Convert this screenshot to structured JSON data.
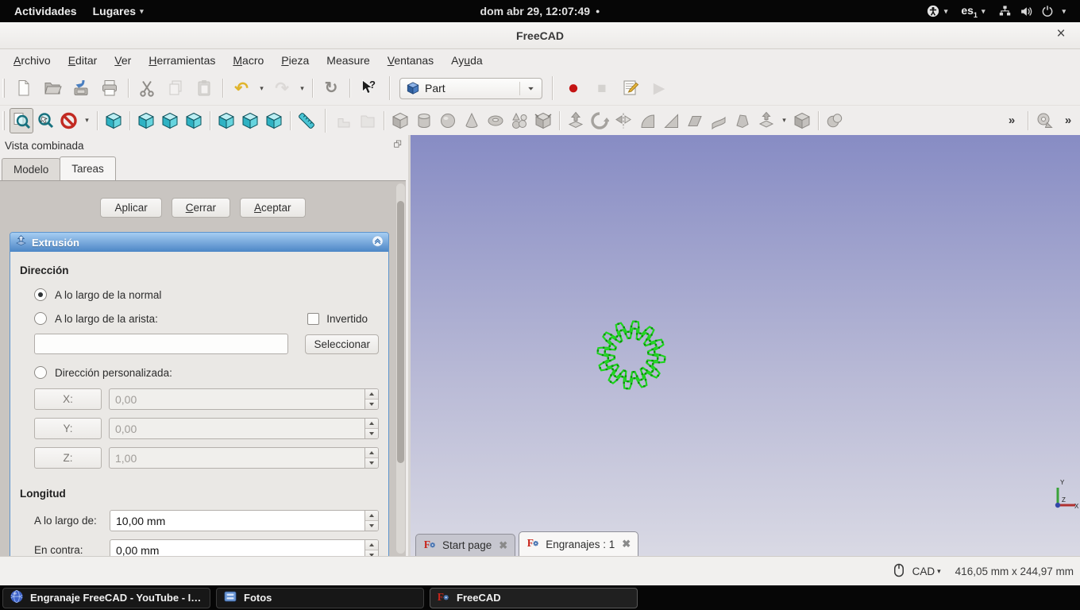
{
  "colors": {
    "accent_blue": "#4c86c6",
    "task_header_gradient_top": "#a6cdf2",
    "task_header_gradient_bottom": "#4c86c6",
    "viewport_gradient_top": "#878cc4",
    "viewport_gradient_bottom": "#d9d9e4",
    "gear_green": "#1ed41e",
    "gear_green_dark": "#0b8f0b",
    "record_red": "#c41414",
    "view_icon_teal": "#2fb2c3"
  },
  "top_bar": {
    "activities_label": "Actividades",
    "places_label": "Lugares",
    "clock": "dom abr 29, 12:07:49",
    "keyboard_layout": "es",
    "keyboard_layout_index": "1"
  },
  "window": {
    "title": "FreeCAD"
  },
  "menu_bar": {
    "items": [
      {
        "id": "archivo",
        "pre": "",
        "key": "A",
        "post": "rchivo"
      },
      {
        "id": "editar",
        "pre": "",
        "key": "E",
        "post": "ditar"
      },
      {
        "id": "ver",
        "pre": "",
        "key": "V",
        "post": "er"
      },
      {
        "id": "herramientas",
        "pre": "",
        "key": "H",
        "post": "erramientas"
      },
      {
        "id": "macro",
        "pre": "",
        "key": "M",
        "post": "acro"
      },
      {
        "id": "pieza",
        "pre": "",
        "key": "P",
        "post": "ieza"
      },
      {
        "id": "measure",
        "pre": "Measure",
        "key": "",
        "post": ""
      },
      {
        "id": "ventanas",
        "pre": "",
        "key": "V",
        "post": "entanas"
      },
      {
        "id": "ayuda",
        "pre": "Ay",
        "key": "u",
        "post": "da"
      }
    ]
  },
  "workbench_selector": {
    "selected": "Part"
  },
  "toolbars": {
    "file": [
      {
        "name": "new-file"
      },
      {
        "name": "open-file"
      },
      {
        "name": "save-file"
      },
      {
        "name": "print"
      },
      {
        "sep": 1
      },
      {
        "name": "cut"
      },
      {
        "name": "copy",
        "disabled": 1
      },
      {
        "name": "paste",
        "disabled": 1
      },
      {
        "sep": 1
      },
      {
        "name": "undo"
      },
      {
        "name": "undo-dropdown",
        "arrow": 1
      },
      {
        "name": "redo",
        "disabled": 1
      },
      {
        "name": "redo-dropdown",
        "arrow": 1
      },
      {
        "sep": 1
      },
      {
        "name": "refresh"
      },
      {
        "sep": 1
      },
      {
        "name": "whatsthis"
      }
    ],
    "macro": [
      {
        "name": "macro-record"
      },
      {
        "name": "macro-stop",
        "disabled": 1
      },
      {
        "name": "macro-edit"
      },
      {
        "name": "macro-play",
        "disabled": 1
      }
    ],
    "view": [
      {
        "name": "fit-all",
        "pressed": 1
      },
      {
        "name": "fit-selection"
      },
      {
        "name": "draw-style"
      },
      {
        "name": "draw-style-dropdown",
        "arrow": 1
      },
      {
        "sep": 1
      },
      {
        "name": "view-axonometric"
      },
      {
        "sep": 1
      },
      {
        "name": "view-front"
      },
      {
        "name": "view-top"
      },
      {
        "name": "view-right"
      },
      {
        "sep": 1
      },
      {
        "name": "view-rear"
      },
      {
        "name": "view-bottom"
      },
      {
        "name": "view-left"
      },
      {
        "sep": 1
      },
      {
        "name": "measure-ruler"
      }
    ],
    "part": [
      {
        "name": "part-compsolid",
        "disabled": 1
      },
      {
        "name": "part-group",
        "disabled": 1
      },
      {
        "sep": 1
      },
      {
        "name": "part-box"
      },
      {
        "name": "part-cylinder"
      },
      {
        "name": "part-sphere"
      },
      {
        "name": "part-cone"
      },
      {
        "name": "part-torus"
      },
      {
        "name": "part-shapebuilder"
      },
      {
        "name": "part-primitives"
      },
      {
        "sep": 1
      },
      {
        "name": "part-extrude"
      },
      {
        "name": "part-revolve"
      },
      {
        "name": "part-mirror"
      },
      {
        "name": "part-fillet"
      },
      {
        "name": "part-chamfer"
      },
      {
        "name": "part-makeface"
      },
      {
        "name": "part-ruled-surface"
      },
      {
        "name": "part-loft"
      },
      {
        "name": "part-offset"
      },
      {
        "name": "offset-dropdown",
        "arrow": 1
      },
      {
        "name": "part-thickness"
      },
      {
        "sep": 1
      },
      {
        "name": "part-boolean"
      },
      {
        "spacer": 1
      },
      {
        "name": "overflow"
      },
      {
        "sep": 1
      },
      {
        "name": "measure-tape"
      },
      {
        "name": "overflow"
      }
    ]
  },
  "combo_view": {
    "title": "Vista combinada",
    "tabs": [
      {
        "id": "modelo",
        "label": "Modelo",
        "active": false
      },
      {
        "id": "tareas",
        "label": "Tareas",
        "active": true
      }
    ],
    "action_buttons": [
      {
        "id": "aplicar",
        "pre": "Aplicar",
        "key": "",
        "post": ""
      },
      {
        "id": "cerrar",
        "pre": "",
        "key": "C",
        "post": "errar"
      },
      {
        "id": "aceptar",
        "pre": "",
        "key": "A",
        "post": "ceptar"
      }
    ],
    "task_panel": {
      "header": "Extrusión",
      "direction_section": {
        "title": "Dirección",
        "radio_normal": {
          "label": "A lo largo de la normal",
          "selected": true
        },
        "radio_edge": {
          "label": "A lo largo de la arista:",
          "selected": false
        },
        "invert_checkbox": {
          "label": "Invertido",
          "checked": false
        },
        "edge_field": {
          "value": ""
        },
        "select_button": "Seleccionar",
        "radio_custom": {
          "label": "Dirección personalizada:",
          "selected": false
        },
        "x": {
          "label": "X:",
          "value": "0,00"
        },
        "y": {
          "label": "Y:",
          "value": "0,00"
        },
        "z": {
          "label": "Z:",
          "value": "1,00"
        }
      },
      "length_section": {
        "title": "Longitud",
        "along": {
          "label": "A lo largo de:",
          "value": "10,00 mm"
        },
        "against": {
          "label": "En contra:",
          "value": "0,00 mm"
        }
      }
    }
  },
  "viewport": {
    "mdi_tabs": [
      {
        "id": "start-page",
        "label": "Start page",
        "active": false
      },
      {
        "id": "engranajes",
        "label": "Engranajes : 1",
        "active": true
      }
    ],
    "axis": {
      "x": "X",
      "y": "Y",
      "z": "Z"
    },
    "gear": {
      "teeth": 12
    }
  },
  "status_bar": {
    "nav_style": "CAD",
    "dimensions": "416,05 mm x 244,97 mm"
  },
  "taskbar": {
    "windows": [
      {
        "id": "browser",
        "title": "Engranaje FreeCAD - YouTube - Ic...",
        "icon": "globe-icon"
      },
      {
        "id": "fotos",
        "title": "Fotos",
        "icon": "photos-icon"
      },
      {
        "id": "freecad",
        "title": "FreeCAD",
        "icon": "freecad-icon",
        "focused": true
      }
    ]
  },
  "icons": {
    "caret_down": "▾",
    "notification_dot": "●",
    "window_close": "×",
    "tab_close": "✖",
    "overflow": "»",
    "undo": "↶",
    "redo": "↷",
    "refresh": "↻",
    "record": "●",
    "stop": "■",
    "play": "▶"
  }
}
